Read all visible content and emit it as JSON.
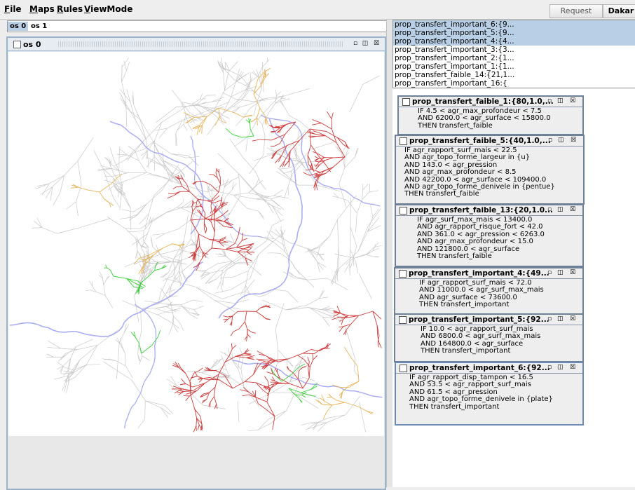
{
  "menu": {
    "items": [
      {
        "ul": "F",
        "rest": "ile"
      },
      {
        "ul": "M",
        "rest": "aps"
      },
      {
        "ul": "R",
        "rest": "ules"
      },
      {
        "ul": "V",
        "rest": "iewMode"
      }
    ],
    "request_label": "Request",
    "dakar_label": "Dakar"
  },
  "tabs": [
    "os 0",
    "os 1"
  ],
  "map_frame": {
    "title": "os 0"
  },
  "colors": {
    "network_gray": "#c9c9c9",
    "network_lavender": "#a9acf2",
    "faible": "#cd3d3d",
    "important": "#e6b55e",
    "green": "#38d038",
    "selection": "#b8cfe5"
  },
  "rule_list": {
    "items": [
      {
        "label": "prop_transfert_important_6:{9...",
        "selected": true
      },
      {
        "label": "prop_transfert_important_5:{9...",
        "selected": true
      },
      {
        "label": "prop_transfert_important_4:{4...",
        "selected": true
      },
      {
        "label": "prop_transfert_important_3:{3...",
        "selected": false
      },
      {
        "label": "prop_transfert_important_2:{1...",
        "selected": false
      },
      {
        "label": "prop_transfert_important_1:{1...",
        "selected": false
      },
      {
        "label": "prop_transfert_faible_14:{21,1...",
        "selected": false
      },
      {
        "label": "prop_transfert_important_16:{",
        "selected": false
      }
    ]
  },
  "rules": [
    {
      "title": "prop_transfert_faible_1:{80,1.0,...",
      "lines": [
        "IF 4.5 < agr_max_profondeur < 7.5",
        "AND 6200.0 < agr_surface < 15800.0",
        "THEN transfert_faible"
      ]
    },
    {
      "title": "prop_transfert_faible_5:{40,1.0,...",
      "lines": [
        "IF agr_rapport_surf_mais < 22.5",
        "AND agr_topo_forme_largeur in {u}",
        "AND 143.0 < agr_pression",
        "AND agr_max_profondeur < 8.5",
        "AND 42200.0 < agr_surface < 109400.0",
        "AND agr_topo_forme_denivele in {pentue}",
        "THEN transfert_faible"
      ]
    },
    {
      "title": "prop_transfert_faible_13:{20,1.0...",
      "lines": [
        "IF agr_surf_max_mais < 13400.0",
        "AND agr_rapport_risque_fort < 42.0",
        "AND 361.0 < agr_pression < 6263.0",
        "AND agr_max_profondeur < 15.0",
        "AND 121800.0 < agr_surface",
        "THEN transfert_faible"
      ]
    },
    {
      "title": "prop_transfert_important_4:{49...",
      "lines": [
        "IF agr_rapport_surf_mais < 72.0",
        "AND 11000.0 < agr_surf_max_mais",
        "AND agr_surface < 73600.0",
        "THEN transfert_important"
      ]
    },
    {
      "title": "prop_transfert_important_5:{92...",
      "lines": [
        "IF 10.0 < agr_rapport_surf_mais",
        "AND 6800.0 < agr_surf_max_mais",
        "AND 164800.0 < agr_surface",
        "THEN transfert_important"
      ]
    },
    {
      "title": "prop_transfert_important_6:{92...",
      "lines": [
        "IF agr_rapport_disp_tampon < 16.5",
        "AND 53.5 < agr_rapport_surf_mais",
        "AND 61.5 < agr_pression",
        "AND agr_topo_forme_denivele in {plate}",
        "THEN transfert_important"
      ]
    }
  ]
}
